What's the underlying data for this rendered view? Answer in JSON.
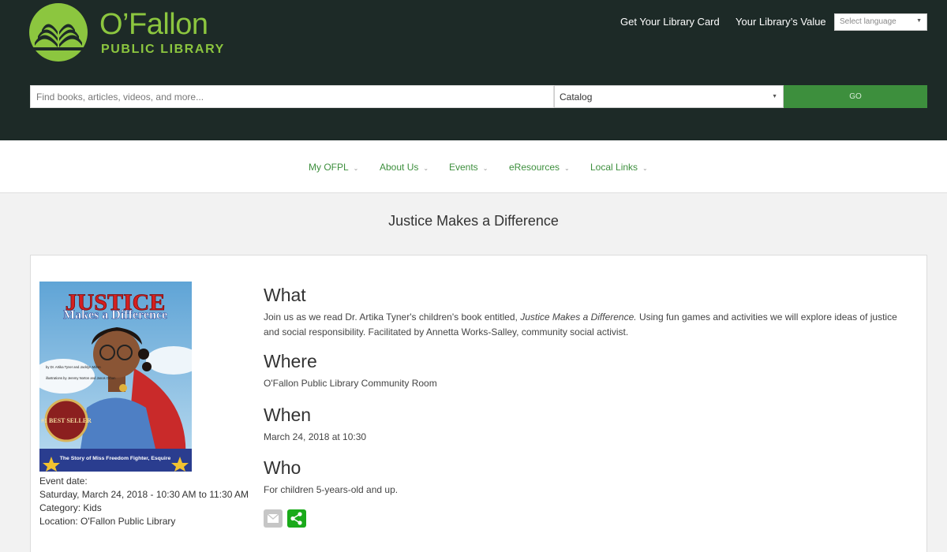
{
  "header": {
    "logo_title": "O’Fallon",
    "logo_subtitle": "PUBLIC LIBRARY",
    "links": [
      "Get Your Library Card",
      "Your Library’s Value"
    ],
    "language_select": "Select language",
    "search_placeholder": "Find books, articles, videos, and more...",
    "catalog_select": "Catalog",
    "go_label": "GO"
  },
  "nav": {
    "items": [
      "My OFPL",
      "About Us",
      "Events",
      "eResources",
      "Local Links"
    ]
  },
  "event": {
    "title": "Justice Makes a Difference",
    "cover": {
      "title_line1": "JUSTICE",
      "title_line2": "Makes a Difference",
      "authors": "by Dr. Artika Tyner and Jacklyn Milton",
      "illustrators": "illustrations by Jeremy Norton and Janos Orban",
      "badge": "#1 BEST SELLER",
      "subtitle": "The Story of Miss Freedom Fighter, Esquire"
    },
    "meta": {
      "date_label": "Event date:",
      "date_value": "Saturday, March 24, 2018 - 10:30 AM to 11:30 AM",
      "category": "Category: Kids",
      "location": "Location: O'Fallon Public Library"
    },
    "what_heading": "What",
    "what_text_1": "Join us as we read Dr. Artika Tyner's children's book entitled, ",
    "what_text_italic": "Justice Makes a Difference.",
    "what_text_2": "  Using fun games and activities we will explore ideas of justice and social responsibility. Facilitated by Annetta Works-Salley, community social activist.",
    "where_heading": "Where",
    "where_text": "O'Fallon Public Library Community Room",
    "when_heading": "When",
    "when_text": "March 24, 2018 at 10:30",
    "who_heading": "Who",
    "who_text": "For children 5-years-old and up."
  },
  "colors": {
    "header_bg": "#1d2a27",
    "brand_green": "#8cc63f",
    "link_green": "#3d8f3d",
    "share_green": "#1aaa1a"
  },
  "icons": {
    "logo": "open-book-logo-icon",
    "email": "envelope-icon",
    "share": "share-icon"
  }
}
